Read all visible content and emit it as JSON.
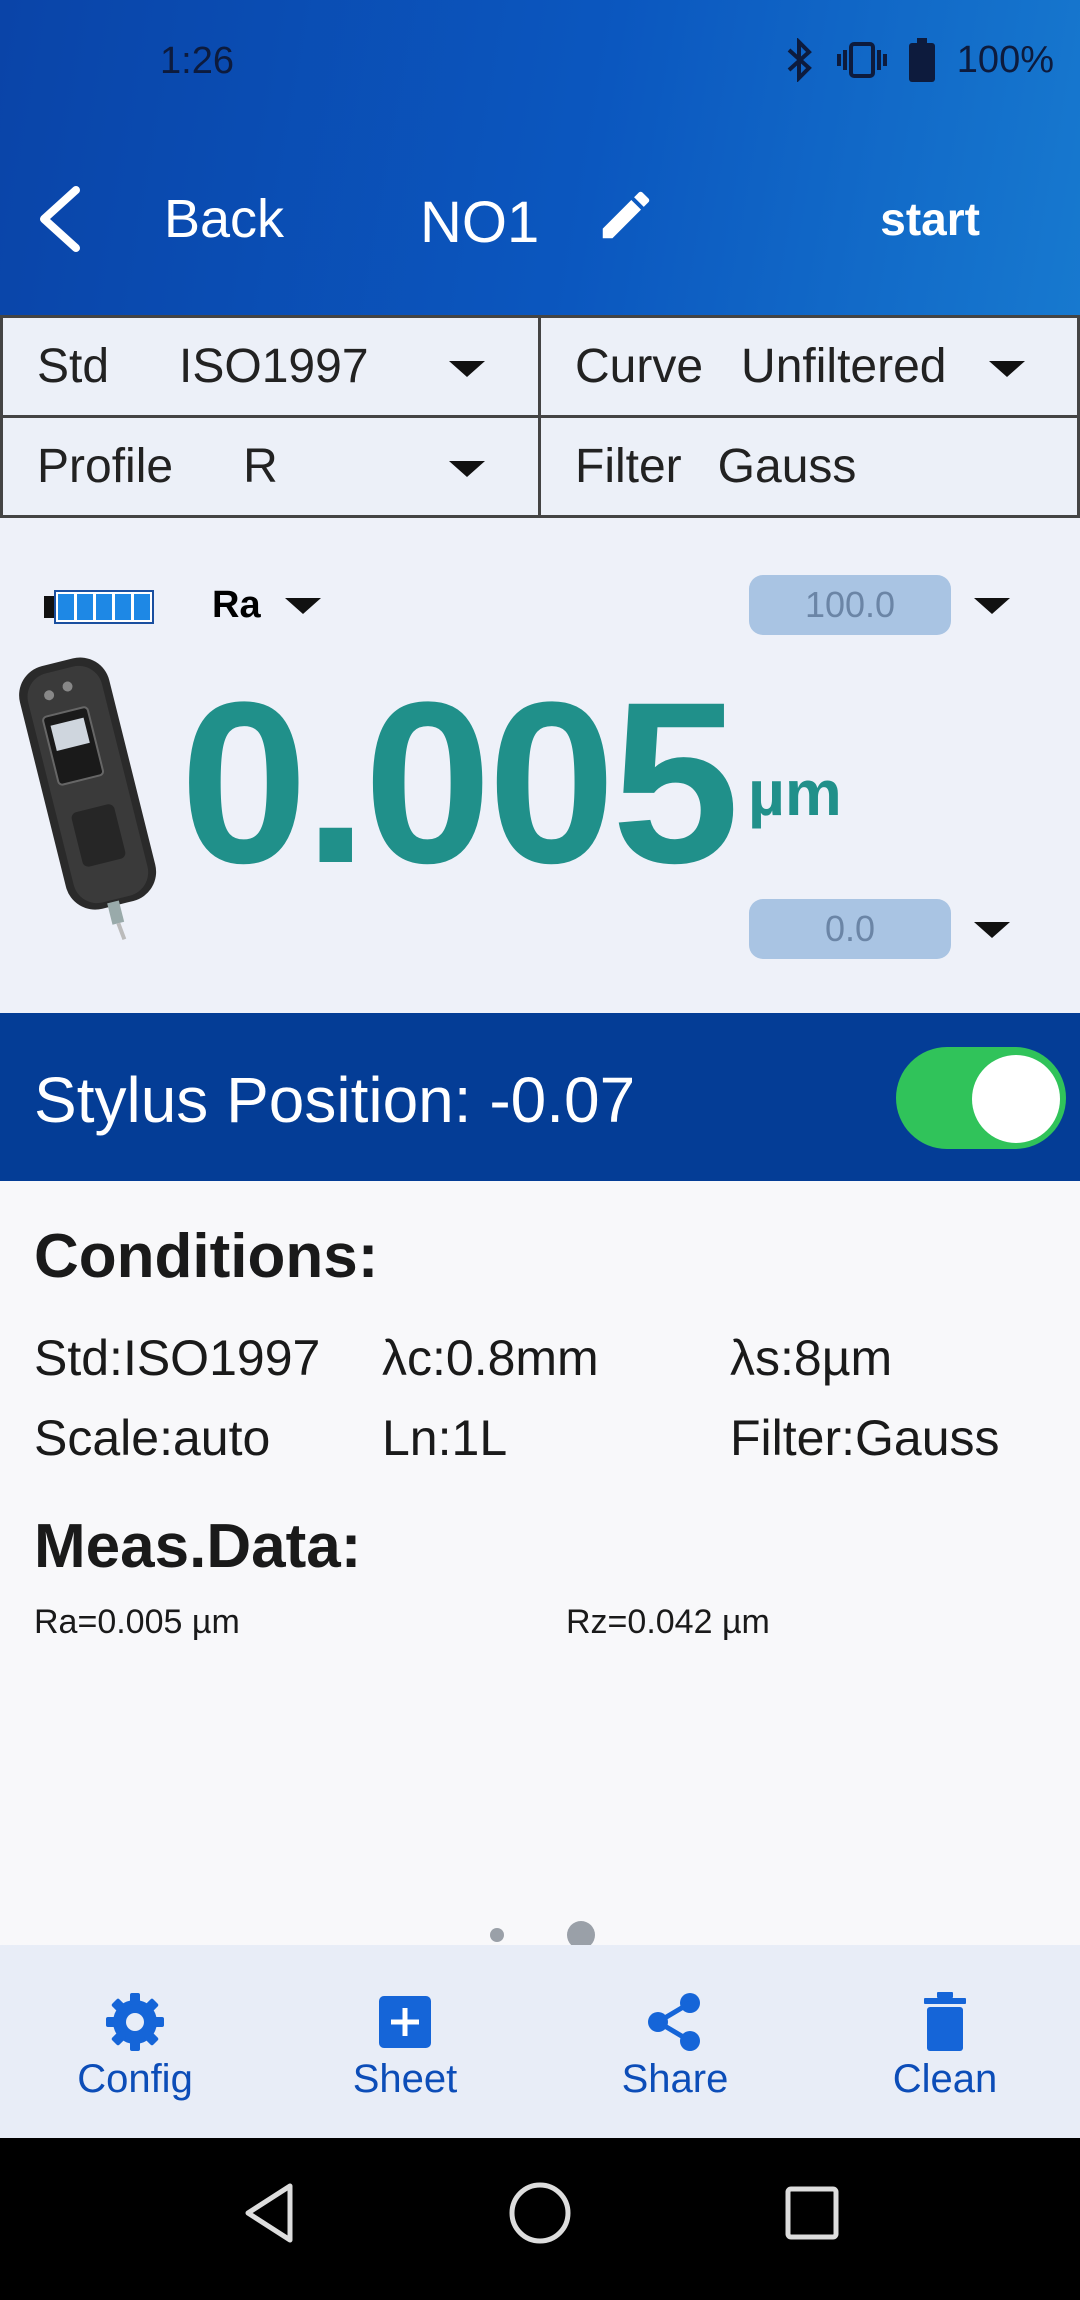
{
  "status_bar": {
    "time": "1:26",
    "battery": "100%"
  },
  "header": {
    "back_label": "Back",
    "title": "NO1",
    "start_label": "start"
  },
  "selectors": {
    "std": {
      "label": "Std",
      "value": "ISO1997"
    },
    "curve": {
      "label": "Curve",
      "value": "Unfiltered"
    },
    "profile": {
      "label": "Profile",
      "value": "R"
    },
    "filter": {
      "label": "Filter",
      "value": "Gauss"
    }
  },
  "reading": {
    "parameter": "Ra",
    "upper_limit": "100.0",
    "lower_limit": "0.0",
    "value": "0.005",
    "unit": "µm",
    "battery_level": 1.0
  },
  "stylus": {
    "text": "Stylus Position: -0.07",
    "toggle_on": true
  },
  "conditions": {
    "heading": "Conditions:",
    "items": [
      "Std:ISO1997",
      "λc:0.8mm",
      "λs:8µm",
      "Scale:auto",
      "Ln:1L",
      "Filter:Gauss"
    ]
  },
  "meas_data": {
    "heading": "Meas.Data:",
    "items": [
      "Ra=0.005 µm",
      "Rz=0.042 µm"
    ]
  },
  "pager": {
    "count": 2,
    "active": 2
  },
  "bottom_nav": {
    "tabs": [
      {
        "label": "Config",
        "icon": "gear-icon"
      },
      {
        "label": "Sheet",
        "icon": "add-box-icon"
      },
      {
        "label": "Share",
        "icon": "share-icon"
      },
      {
        "label": "Clean",
        "icon": "trash-icon"
      }
    ]
  },
  "colors": {
    "header": "#0b57bf",
    "accent": "#20908a",
    "stylus_bar": "#043d96",
    "toggle_on": "#30c35a",
    "nav_blue": "#0c4db8"
  }
}
